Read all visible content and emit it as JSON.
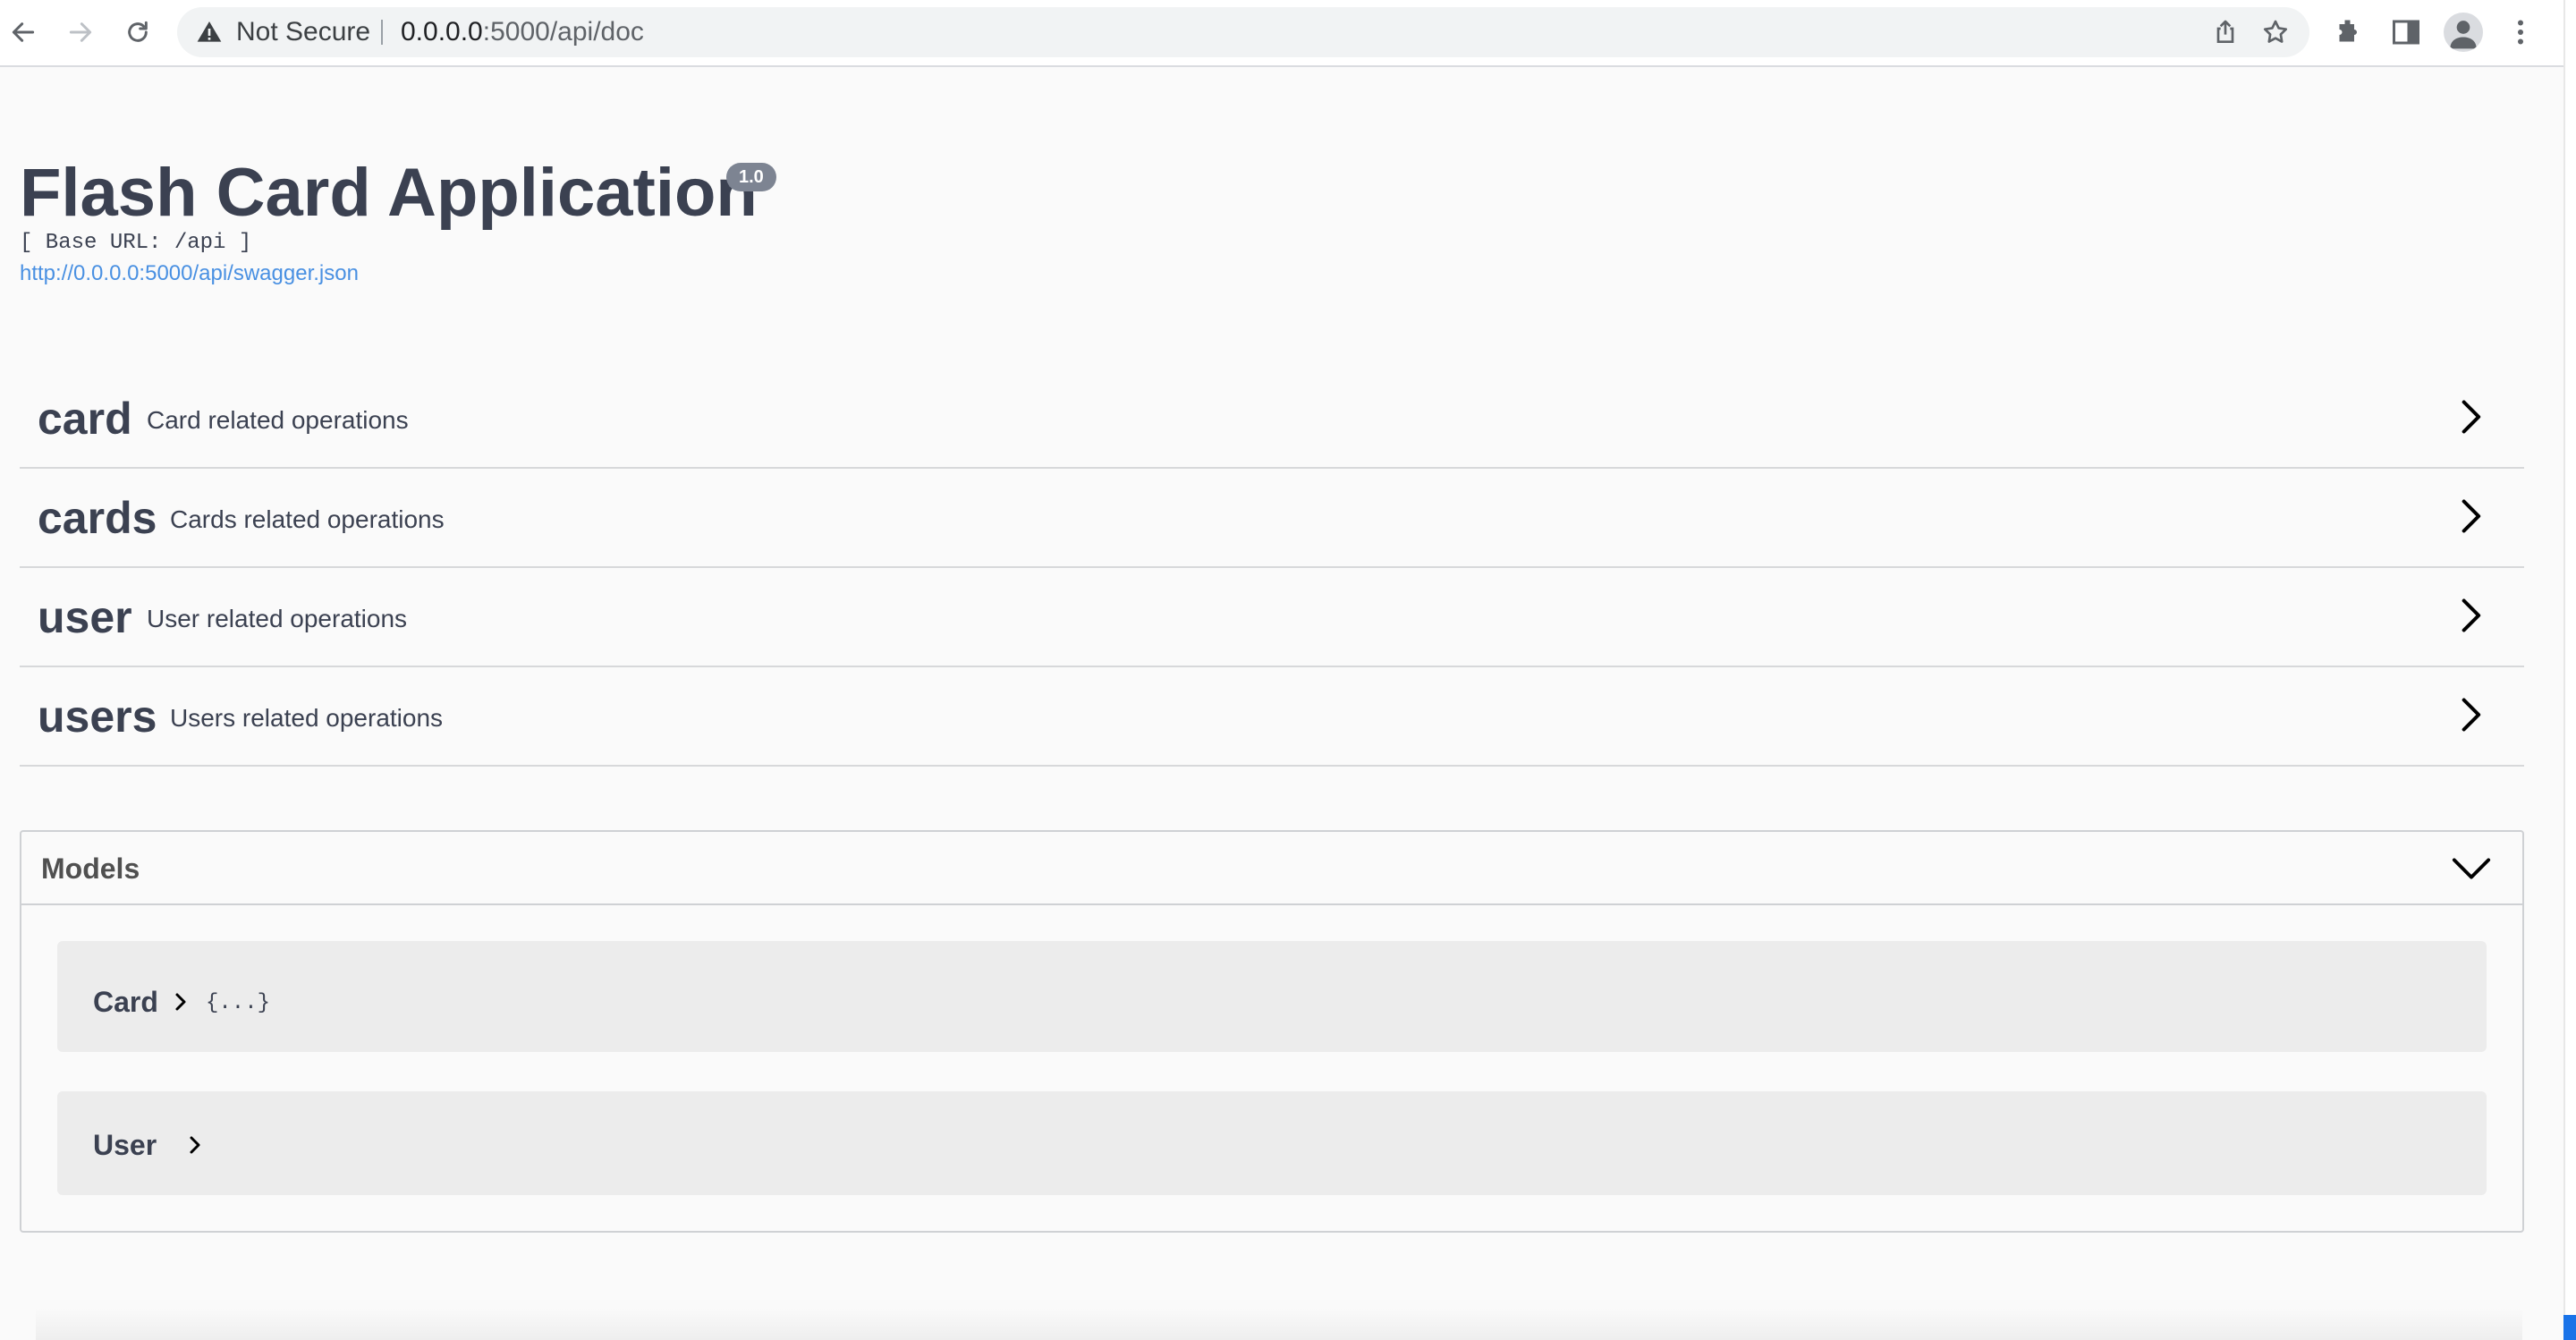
{
  "browser": {
    "security_label": "Not Secure",
    "url_host": "0.0.0.0",
    "url_path": ":5000/api/doc"
  },
  "api": {
    "title": "Flash Card Application",
    "version": "1.0",
    "base_url": "[ Base URL: /api ]",
    "spec_link": "http://0.0.0.0:5000/api/swagger.json"
  },
  "tags": [
    {
      "name": "card",
      "description": "Card related operations"
    },
    {
      "name": "cards",
      "description": "Cards related operations"
    },
    {
      "name": "user",
      "description": "User related operations"
    },
    {
      "name": "users",
      "description": "Users related operations"
    }
  ],
  "models": {
    "title": "Models",
    "items": [
      {
        "name": "Card",
        "preview": "{...}"
      },
      {
        "name": "User",
        "preview": ""
      }
    ]
  },
  "colors": {
    "text": "#3b4151",
    "link": "#4990e2",
    "version_badge": "#7d8492",
    "model_bg": "#ececec"
  },
  "icons": [
    "back-arrow-icon",
    "forward-arrow-icon",
    "reload-icon",
    "warning-icon",
    "share-icon",
    "star-icon",
    "extensions-icon",
    "side-panel-icon",
    "profile-icon",
    "more-vertical-icon",
    "chevron-right-icon",
    "chevron-down-icon"
  ]
}
